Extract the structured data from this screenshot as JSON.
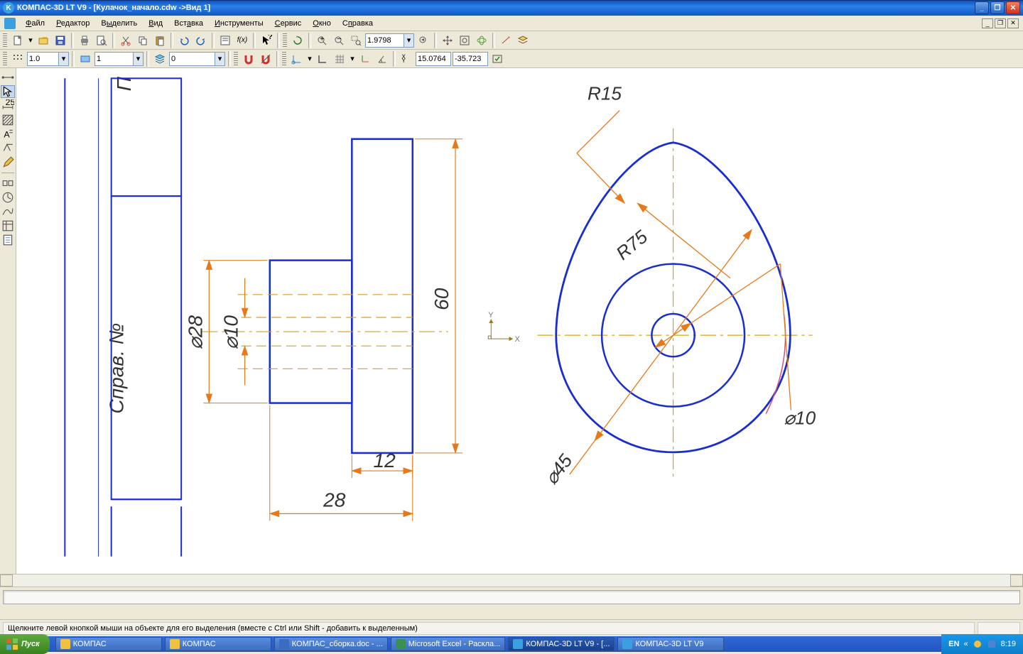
{
  "app": {
    "title": "КОМПАС-3D LT V9 - [Кулачок_начало.cdw ->Вид 1]",
    "icon": "K"
  },
  "menu": {
    "items": [
      "Файл",
      "Редактор",
      "Выделить",
      "Вид",
      "Вставка",
      "Инструменты",
      "Сервис",
      "Окно",
      "Справка"
    ]
  },
  "toolbar1": {
    "zoom": "1.9798"
  },
  "toolbar2": {
    "lineweight": "1.0",
    "layer": "1",
    "linetype": "0",
    "x": "15.0764",
    "y": "-35.723"
  },
  "drawing": {
    "left_text": "Справ. №",
    "left_top": "П",
    "d28": "⌀28",
    "d10": "⌀10",
    "h60": "60",
    "w12": "12",
    "w28": "28",
    "r15": "R15",
    "r75": "R75",
    "d45": "⌀45",
    "d10b": "⌀10",
    "axes": {
      "y": "Y",
      "x": "X"
    }
  },
  "status": {
    "hint": "Щелкните левой кнопкой мыши на объекте для его выделения (вместе с Ctrl или Shift - добавить к выделенным)"
  },
  "taskbar": {
    "start": "Пуск",
    "items": [
      {
        "label": "КОМПАС",
        "icon": "folder"
      },
      {
        "label": "КОМПАС",
        "icon": "folder"
      },
      {
        "label": "КОМПАС_сборка.doc - ...",
        "icon": "word"
      },
      {
        "label": "Microsoft Excel - Раскла...",
        "icon": "excel"
      },
      {
        "label": "КОМПАС-3D LT V9 - [...",
        "icon": "kompas",
        "active": true
      },
      {
        "label": "КОМПАС-3D LT V9",
        "icon": "kompas"
      }
    ],
    "lang": "EN",
    "clock": "8:19"
  }
}
